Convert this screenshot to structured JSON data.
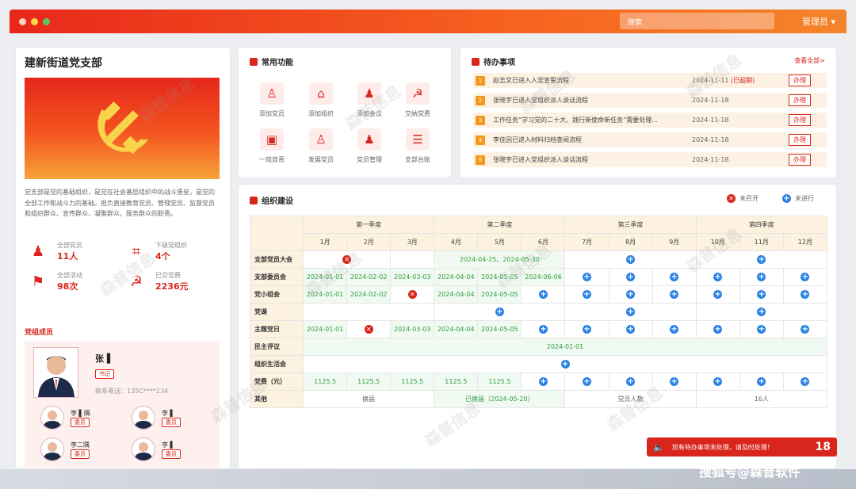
{
  "topbar": {
    "search_placeholder": "搜索",
    "admin_label": "管理员 ▾"
  },
  "party": {
    "name": "建新街道党支部",
    "description": "党支部是党的基础组织，是党在社会基层组织中的战斗堡垒，是党的全部工作和战斗力的基础。担负直接教育党员、管理党员、监督党员和组织群众、宣传群众、凝聚群众、服务群众的职责。"
  },
  "stats": [
    {
      "label": "全部党员",
      "value": "11人",
      "icon": "member-icon"
    },
    {
      "label": "下级党组织",
      "value": "4个",
      "icon": "org-tree-icon"
    },
    {
      "label": "全部活动",
      "value": "98次",
      "icon": "flag-icon"
    },
    {
      "label": "已交党费",
      "value": "2236元",
      "icon": "party-fee-icon"
    }
  ],
  "members": {
    "section_title": "党组成员",
    "leader": {
      "name": "张 ▌",
      "role": "书记",
      "phone": "联系电话：135C****234"
    },
    "others": [
      {
        "name": "李 ▌隅",
        "role": "委员"
      },
      {
        "name": "李 ▌",
        "role": "委员"
      },
      {
        "name": "李二隅",
        "role": "委员"
      },
      {
        "name": "李 ▌",
        "role": "委员"
      }
    ]
  },
  "functions": {
    "title": "常用功能",
    "items": [
      {
        "label": "添加党员",
        "icon": "add-member-icon"
      },
      {
        "label": "添加组织",
        "icon": "add-org-icon"
      },
      {
        "label": "添加会议",
        "icon": "meeting-icon"
      },
      {
        "label": "交纳党费",
        "icon": "pay-fee-icon"
      },
      {
        "label": "一岗双责",
        "icon": "duty-icon"
      },
      {
        "label": "发展党员",
        "icon": "develop-icon"
      },
      {
        "label": "党员管理",
        "icon": "manage-icon"
      },
      {
        "label": "支部台账",
        "icon": "ledger-icon"
      }
    ]
  },
  "todo": {
    "title": "待办事项",
    "view_all": "查看全部>",
    "action": "办理",
    "items": [
      {
        "num": "1",
        "text": "赵志文已进入入党宣誓流程",
        "date": "2024-11-11",
        "overdue": "(已超期)"
      },
      {
        "num": "2",
        "text": "张晓宇已进入党组织派人谈话流程",
        "date": "2024-11-18",
        "overdue": ""
      },
      {
        "num": "3",
        "text": "工作任务“学习党的二十大、践行新使命新任务”需要处理...",
        "date": "2024-11-18",
        "overdue": ""
      },
      {
        "num": "4",
        "text": "李佳因已进入材料归档查阅流程",
        "date": "2024-11-18",
        "overdue": ""
      },
      {
        "num": "5",
        "text": "张晓宇已进入党组织派人谈话流程",
        "date": "2024-11-18",
        "overdue": ""
      }
    ]
  },
  "org": {
    "title": "组织建设",
    "legend_closed": "未召开",
    "legend_pending": "未进行",
    "quarters": [
      "第一季度",
      "第二季度",
      "第三季度",
      "第四季度"
    ],
    "months": [
      "1月",
      "2月",
      "3月",
      "4月",
      "5月",
      "6月",
      "7月",
      "8月",
      "9月",
      "10月",
      "11月",
      "12月"
    ],
    "rows": [
      "支部党员大会",
      "支部委员会",
      "党小组会",
      "党课",
      "主题党日",
      "民主评议",
      "组织生活会",
      "党费（元）",
      "其他"
    ],
    "cells": {
      "r1_q2": "2024-04-25、2024-05-30",
      "r2": [
        "2024-01-01",
        "2024-02-02",
        "2024-03-03",
        "2024-04-04",
        "2024-05-05",
        "2024-06-06"
      ],
      "r3": [
        "2024-01-01",
        "2024-02-02",
        "2024-04-04",
        "2024-05-05"
      ],
      "r5": [
        "2024-01-01",
        "2024-03-03",
        "2024-04-04",
        "2024-05-05"
      ],
      "r6": "2024-01-01",
      "r8": [
        "1125.5",
        "1125.5",
        "1125.5",
        "1125.5",
        "1125.5"
      ],
      "r9": [
        "换届",
        "已换届（2024-05-20）",
        "党员人数",
        "16人"
      ]
    }
  },
  "alert": {
    "text": "您有待办事项未处理，请及时处理！",
    "count": "18"
  },
  "watermark": "搜狐号@森普软件",
  "wm_text": "森普信息"
}
